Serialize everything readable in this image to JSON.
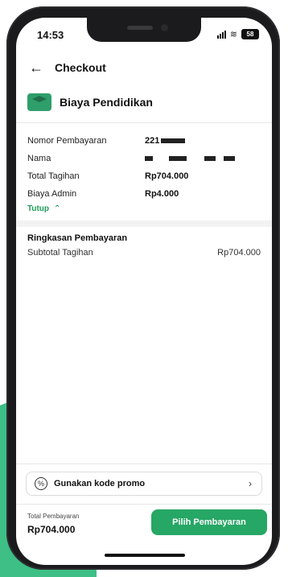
{
  "status": {
    "time": "14:53",
    "battery": "58"
  },
  "header": {
    "title": "Checkout"
  },
  "biller": {
    "name": "Biaya Pendidikan"
  },
  "details": [
    {
      "label": "Nomor Pembayaran",
      "value": "221"
    },
    {
      "label": "Nama",
      "value": ""
    },
    {
      "label": "Total Tagihan",
      "value": "Rp704.000"
    },
    {
      "label": "Biaya Admin",
      "value": "Rp4.000"
    }
  ],
  "toggle": {
    "label": "Tutup"
  },
  "summary": {
    "title": "Ringkasan Pembayaran",
    "subtotal_label": "Subtotal Tagihan",
    "subtotal_value": "Rp704.000"
  },
  "promo": {
    "label": "Gunakan kode promo"
  },
  "footer": {
    "total_label": "Total Pembayaran",
    "total_value": "Rp704.000",
    "pay_button": "Pilih Pembayaran"
  },
  "colors": {
    "accent": "#26a765",
    "background_accent": "#3dbf86"
  }
}
